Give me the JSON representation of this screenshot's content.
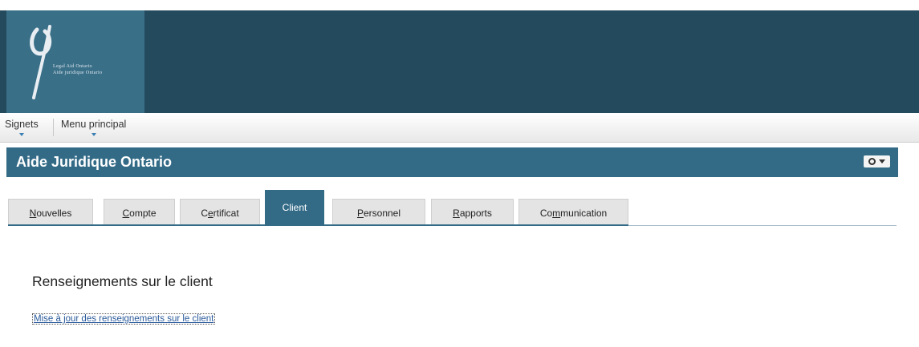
{
  "logo": {
    "line1": "Legal Aid Ontario",
    "line2": "Aide juridique Ontario"
  },
  "menubar": {
    "bookmarks_label": "Signets",
    "main_menu_label": "Menu principal"
  },
  "header": {
    "title": "Aide Juridique Ontario"
  },
  "tabs": [
    {
      "pre": "",
      "u": "N",
      "post": "ouvelles"
    },
    {
      "pre": "",
      "u": "C",
      "post": "ompte"
    },
    {
      "pre": "C",
      "u": "e",
      "post": "rtificat"
    },
    {
      "pre": "Client",
      "u": "",
      "post": ""
    },
    {
      "pre": "",
      "u": "P",
      "post": "ersonnel"
    },
    {
      "pre": "",
      "u": "R",
      "post": "apports"
    },
    {
      "pre": "Co",
      "u": "m",
      "post": "munication"
    }
  ],
  "main": {
    "section_title": "Renseignements sur le client",
    "update_link": "Mise à jour des renseignements sur le client"
  },
  "colors": {
    "banner": "#244a5d",
    "accent": "#336b87",
    "link": "#2a5a9b"
  },
  "icons": {
    "settings": "gear-icon",
    "settings_menu": "chevron-down-icon"
  }
}
